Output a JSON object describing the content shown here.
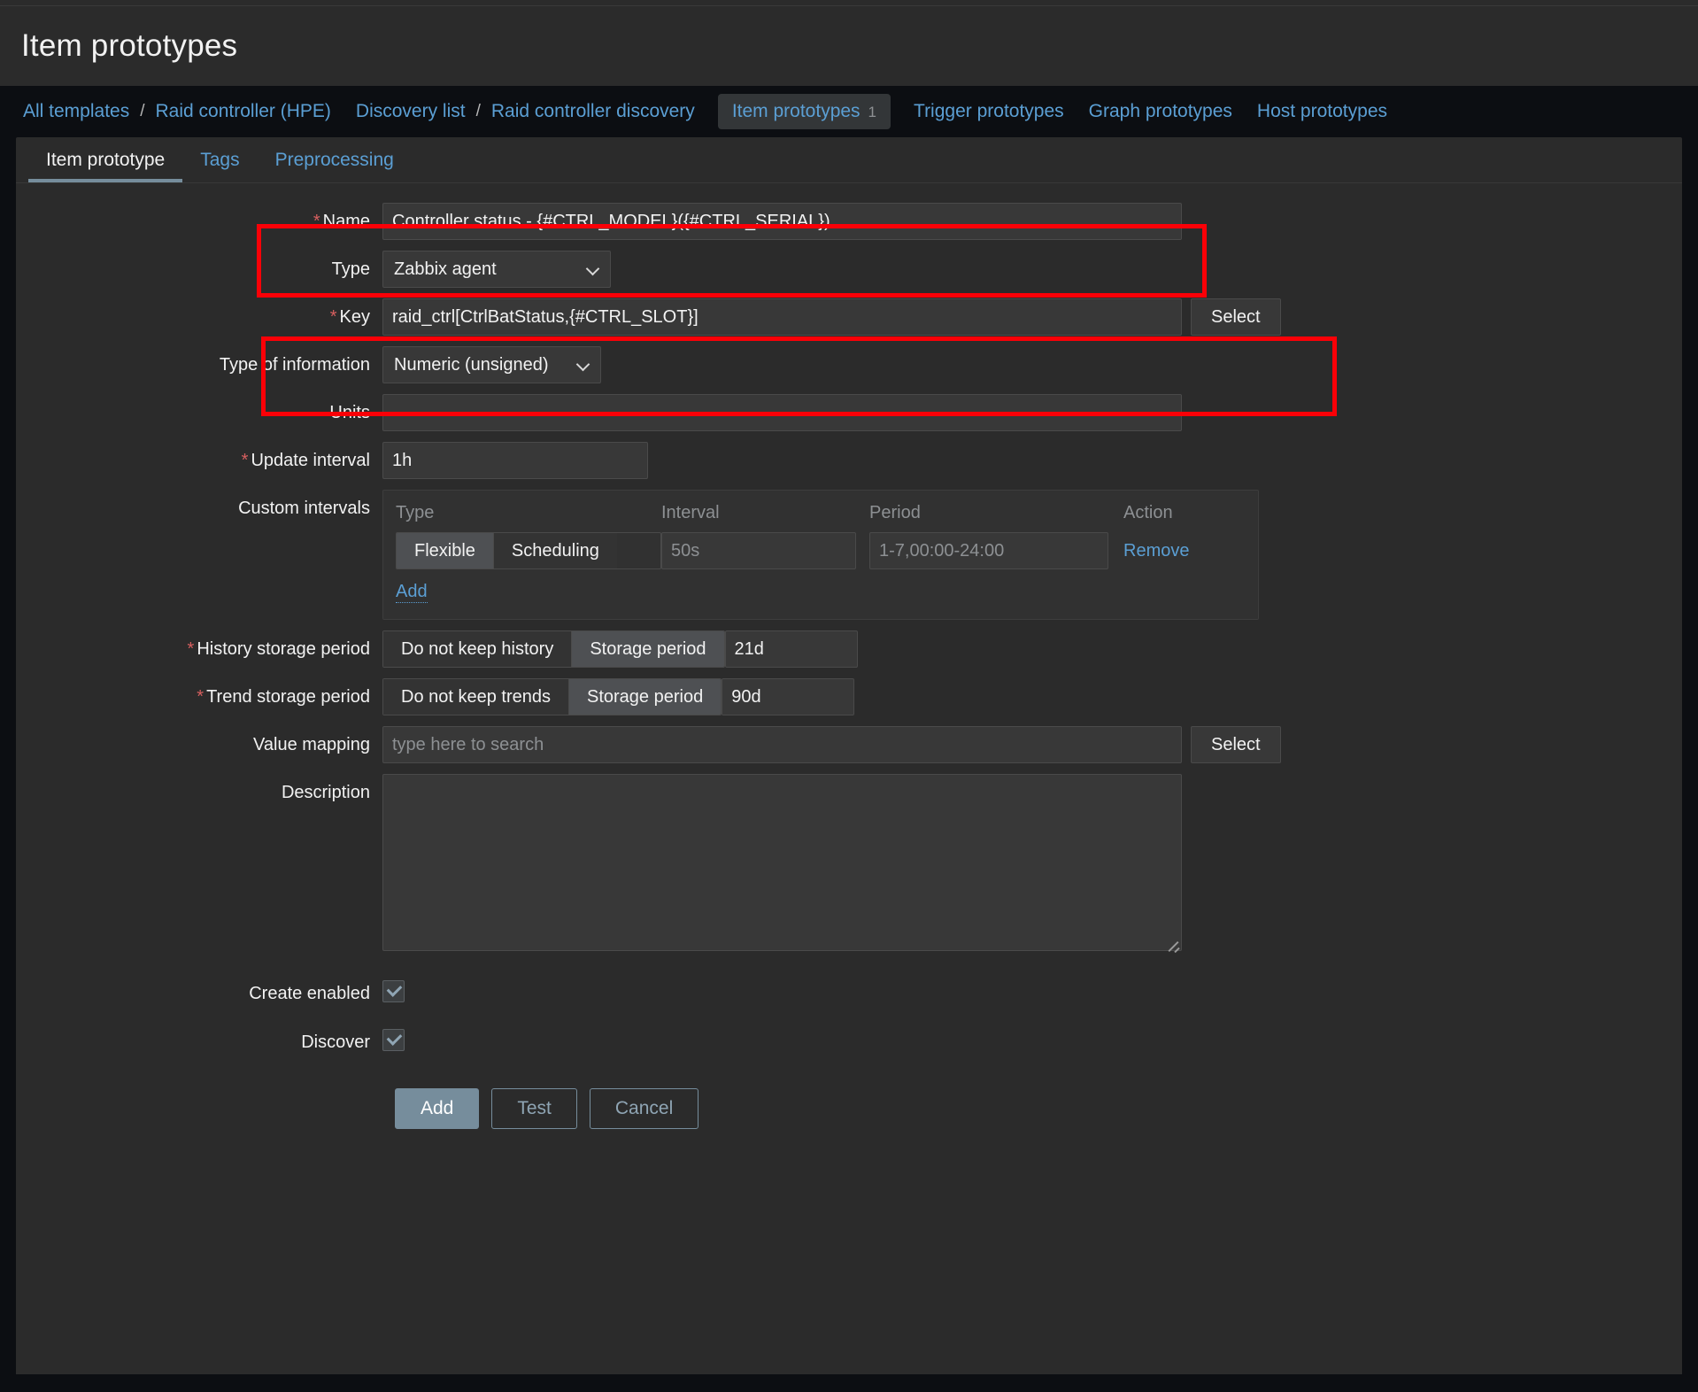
{
  "header": {
    "title": "Item prototypes"
  },
  "breadcrumb": {
    "sep": "/",
    "links": [
      {
        "label": "All templates"
      },
      {
        "label": "Raid controller (HPE)"
      },
      {
        "label": "Discovery list"
      },
      {
        "label": "Raid controller discovery"
      }
    ],
    "current": {
      "label": "Item prototypes",
      "count": "1"
    },
    "siblings": [
      {
        "label": "Trigger prototypes"
      },
      {
        "label": "Graph prototypes"
      },
      {
        "label": "Host prototypes"
      }
    ]
  },
  "tabs": [
    {
      "label": "Item prototype",
      "active": true
    },
    {
      "label": "Tags",
      "active": false
    },
    {
      "label": "Preprocessing",
      "active": false
    }
  ],
  "form": {
    "name": {
      "label": "Name",
      "required": "*",
      "value": "Controller status - {#CTRL_MODEL}({#CTRL_SERIAL})"
    },
    "type": {
      "label": "Type",
      "value": "Zabbix agent"
    },
    "key": {
      "label": "Key",
      "required": "*",
      "value": "raid_ctrl[CtrlBatStatus,{#CTRL_SLOT}]",
      "select_label": "Select"
    },
    "type_of_information": {
      "label": "Type of information",
      "value": "Numeric (unsigned)"
    },
    "units": {
      "label": "Units",
      "value": ""
    },
    "update_interval": {
      "label": "Update interval",
      "required": "*",
      "value": "1h"
    },
    "custom_intervals": {
      "label": "Custom intervals",
      "columns": [
        "Type",
        "Interval",
        "Period",
        "Action"
      ],
      "rows": [
        {
          "type_options": [
            "Flexible",
            "Scheduling"
          ],
          "type_selected": "Flexible",
          "interval_placeholder": "50s",
          "interval_value": "",
          "period_placeholder": "1-7,00:00-24:00",
          "period_value": "",
          "action_label": "Remove"
        }
      ],
      "add_label": "Add"
    },
    "history_storage_period": {
      "label": "History storage period",
      "required": "*",
      "options": [
        "Do not keep history",
        "Storage period"
      ],
      "selected": "Storage period",
      "value": "21d"
    },
    "trend_storage_period": {
      "label": "Trend storage period",
      "required": "*",
      "options": [
        "Do not keep trends",
        "Storage period"
      ],
      "selected": "Storage period",
      "value": "90d"
    },
    "value_mapping": {
      "label": "Value mapping",
      "placeholder": "type here to search",
      "value": "",
      "select_label": "Select"
    },
    "description": {
      "label": "Description",
      "value": ""
    },
    "create_enabled": {
      "label": "Create enabled",
      "checked": true
    },
    "discover": {
      "label": "Discover",
      "checked": true
    }
  },
  "footer": {
    "add_label": "Add",
    "test_label": "Test",
    "cancel_label": "Cancel"
  },
  "colors": {
    "accent_link": "#5b9fd4",
    "required_star": "#d75f5f",
    "highlight_box": "#fb0007",
    "primary_button": "#768d9c",
    "panel_bg": "#2b2b2b",
    "page_bg": "#0c0e12"
  }
}
